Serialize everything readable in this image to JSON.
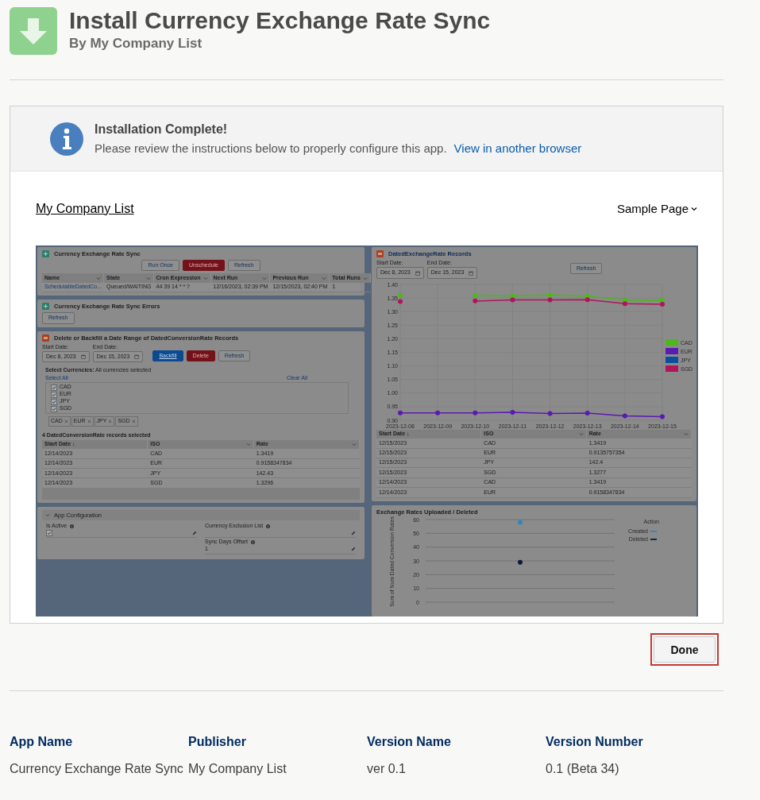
{
  "header": {
    "title": "Install Currency Exchange Rate Sync",
    "subtitle": "By My Company List"
  },
  "banner": {
    "title": "Installation Complete!",
    "message": "Please review the instructions below to properly configure this app.",
    "link": "View in another browser"
  },
  "app_page": {
    "brand_link": "My Company List",
    "page_menu": "Sample Page"
  },
  "preview": {
    "sync_card": {
      "title": "Currency Exchange Rate Sync",
      "buttons": [
        {
          "label": "Run Once",
          "kind": "neutral"
        },
        {
          "label": "Unschedule",
          "kind": "destructive"
        },
        {
          "label": "Refresh",
          "kind": "neutral"
        }
      ],
      "columns": [
        {
          "label": "Name",
          "has_menu": true
        },
        {
          "label": "State",
          "has_menu": true
        },
        {
          "label": "Cron Expression",
          "has_menu": true
        },
        {
          "label": "Next Run",
          "has_menu": true
        },
        {
          "label": "Previous Run",
          "has_menu": true
        },
        {
          "label": "Total Runs",
          "has_menu": true
        }
      ],
      "rows": [
        [
          {
            "text": "SchedulableDatedCo...",
            "kind": "link"
          },
          {
            "text": "Queued/WAITING",
            "kind": "text"
          },
          {
            "text": "44 39 14 * * ?",
            "kind": "text"
          },
          {
            "text": "12/16/2023, 02:39 PM",
            "kind": "text"
          },
          {
            "text": "12/15/2023, 02:40 PM",
            "kind": "text"
          },
          {
            "text": "1",
            "kind": "text"
          }
        ]
      ]
    },
    "errors_card": {
      "title": "Currency Exchange Rate Sync Errors",
      "button": "Refresh"
    },
    "backfill_card": {
      "title": "Delete or Backfill a Date Range of DatedConversionRate Records",
      "start_label": "Start Date:",
      "start_value": "Dec 8, 2023",
      "end_label": "End Date:",
      "end_value": "Dec 15, 2023",
      "buttons": [
        {
          "label": "Backfill",
          "kind": "brand"
        },
        {
          "label": "Delete",
          "kind": "destructive"
        },
        {
          "label": "Refresh",
          "kind": "neutral"
        }
      ],
      "currencies_label": "**Select Currencies:** All currencies selected",
      "select_all": "Select All",
      "clear_all": "Clear All",
      "currencies": [
        {
          "label": "CAD",
          "checked": true
        },
        {
          "label": "EUR",
          "checked": true
        },
        {
          "label": "JPY",
          "checked": true
        },
        {
          "label": "SGD",
          "checked": true
        }
      ],
      "pills": [
        "CAD",
        "EUR",
        "JPY",
        "SGD"
      ],
      "records_caption": "4 DatedConversionRate records selected",
      "columns": [
        {
          "label": "Start Date ↓",
          "has_menu": false
        },
        {
          "label": "ISO",
          "has_menu": true
        },
        {
          "label": "Rate",
          "has_menu": true
        }
      ],
      "rows": [
        [
          "12/14/2023",
          "CAD",
          "1.3419"
        ],
        [
          "12/14/2023",
          "EUR",
          "0.9158347834"
        ],
        [
          "12/14/2023",
          "JPY",
          "142.43"
        ],
        [
          "12/14/2023",
          "SGD",
          "1.3296"
        ]
      ]
    },
    "config_card": {
      "title": "App Configuration",
      "left_fields": [
        {
          "label": "Is Active",
          "kind": "checkbox",
          "checked": true
        }
      ],
      "right_fields": [
        {
          "label": "Currency Exclusion List",
          "kind": "text"
        },
        {
          "label": "Sync Days Offset",
          "kind": "text",
          "value": "1"
        }
      ]
    },
    "rates_card": {
      "title": "DatedExchangeRate Records",
      "start_label": "Start Date:",
      "start_value": "Dec 8, 2023",
      "end_label": "End Date:",
      "end_value": "Dec 15, 2023",
      "button": "Refresh",
      "chart_data": {
        "type": "line",
        "categories": [
          "2023-12-08",
          "2023-12-09",
          "2023-12-10",
          "2023-12-11",
          "2023-12-12",
          "2023-12-13",
          "2023-12-14",
          "2023-12-15"
        ],
        "ylim": [
          0.9,
          1.4
        ],
        "grid": true,
        "legend": true,
        "yticks": [
          {
            "value": 1.4,
            "label": "1.40"
          },
          {
            "value": 1.35,
            "label": "1.35"
          },
          {
            "value": 1.3,
            "label": "1.30"
          },
          {
            "value": 1.25,
            "label": "1.25"
          },
          {
            "value": 1.2,
            "label": "1.20"
          },
          {
            "value": 1.15,
            "label": "1.15"
          },
          {
            "value": 1.1,
            "label": "1.10"
          },
          {
            "value": 1.05,
            "label": "1.05"
          },
          {
            "value": 1.0,
            "label": "1.00"
          },
          {
            "value": 0.95,
            "label": "0.95"
          },
          {
            "value": 0.9,
            "label": "0.90"
          }
        ],
        "series": [
          {
            "name": "CAD",
            "color": "#4cb81c",
            "marker": true,
            "values": [
              1.36,
              null,
              1.36,
              1.358,
              1.361,
              1.357,
              1.342,
              1.342
            ]
          },
          {
            "name": "EUR",
            "color": "#5a1bb0",
            "marker": true,
            "values": [
              0.927,
              0.927,
              0.927,
              0.929,
              0.925,
              0.926,
              0.916,
              0.913
            ]
          },
          {
            "name": "JPY",
            "color": "#0a4ea0",
            "values": [
              null,
              null,
              null,
              null,
              null,
              null,
              null,
              null
            ]
          },
          {
            "name": "SGD",
            "color": "#b0145a",
            "marker": true,
            "values": [
              1.337,
              null,
              1.339,
              1.343,
              1.343,
              1.344,
              1.329,
              1.327
            ]
          }
        ]
      },
      "columns": [
        {
          "label": "Start Date ↓",
          "has_menu": false
        },
        {
          "label": "ISO",
          "has_menu": true
        },
        {
          "label": "Rate",
          "has_menu": true
        }
      ],
      "rows": [
        [
          "12/15/2023",
          "CAD",
          "1.3419"
        ],
        [
          "12/15/2023",
          "EUR",
          "0.9135757354"
        ],
        [
          "12/15/2023",
          "JPY",
          "142.4"
        ],
        [
          "12/15/2023",
          "SGD",
          "1.3277"
        ],
        [
          "12/14/2023",
          "CAD",
          "1.3419"
        ],
        [
          "12/14/2023",
          "EUR",
          "0.9158347834"
        ]
      ]
    },
    "uploads_card": {
      "title": "Exchange Rates Uploaded / Deleted",
      "chart_data": {
        "type": "scatter",
        "categories": [
          null
        ],
        "ylabel": "Sum of Num Dated Conversion Rates",
        "ylim": [
          0,
          60
        ],
        "yticks": [
          0,
          10,
          20,
          30,
          40,
          50,
          60
        ],
        "grid": true,
        "legend": {
          "title": "Action"
        },
        "series": [
          {
            "name": "Created",
            "color": "#2f86c0",
            "values": [
              58
            ]
          },
          {
            "name": "Deleted",
            "color": "#0d1b3a",
            "values": [
              29
            ]
          }
        ]
      }
    }
  },
  "done_button": "Done",
  "details": [
    {
      "heading": "App Name",
      "value": "Currency Exchange Rate Sync"
    },
    {
      "heading": "Publisher",
      "value": "My Company List"
    },
    {
      "heading": "Version Name",
      "value": "ver 0.1"
    },
    {
      "heading": "Version Number",
      "value": "0.1 (Beta 34)"
    }
  ]
}
